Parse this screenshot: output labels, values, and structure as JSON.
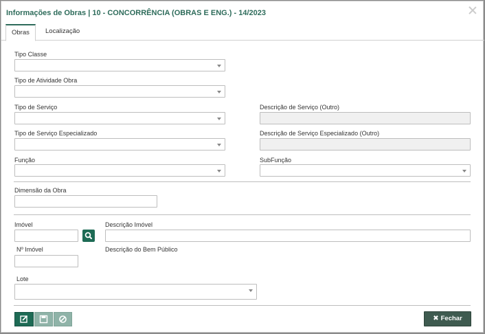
{
  "dialog": {
    "title": "Informações de Obras | 10 - CONCORRÊNCIA (OBRAS E ENG.) - 14/2023"
  },
  "tabs": [
    {
      "label": "Obras",
      "active": true
    },
    {
      "label": "Localização",
      "active": false
    }
  ],
  "form": {
    "tipo_classe": {
      "label": "Tipo Classe",
      "value": ""
    },
    "tipo_atividade": {
      "label": "Tipo de Atividade Obra",
      "value": ""
    },
    "tipo_servico": {
      "label": "Tipo de Serviço",
      "value": ""
    },
    "descricao_servico_outro": {
      "label": "Descrição de Serviço (Outro)",
      "value": ""
    },
    "tipo_servico_especializado": {
      "label": "Tipo de Serviço Especializado",
      "value": ""
    },
    "descricao_servico_especializado_outro": {
      "label": "Descrição de Serviço Especializado (Outro)",
      "value": ""
    },
    "funcao": {
      "label": "Função",
      "value": ""
    },
    "subfuncao": {
      "label": "SubFunção",
      "value": ""
    },
    "dimensao": {
      "label": "Dimensão da Obra",
      "value": ""
    },
    "imovel": {
      "label": "Imóvel",
      "value": ""
    },
    "descricao_imovel": {
      "label": "Descrição Imóvel",
      "value": ""
    },
    "n_imovel": {
      "label": "Nº Imóvel",
      "value": ""
    },
    "descricao_bem_publico": {
      "label": "Descrição do Bem Público"
    },
    "lote": {
      "label": "Lote",
      "value": ""
    }
  },
  "footer": {
    "fechar_label": "Fechar"
  },
  "colors": {
    "accent": "#1e6b55",
    "title": "#2d6b5a",
    "button_disabled": "#8fb3a8",
    "close_button": "#3f5b50"
  },
  "icons": [
    "search-icon",
    "edit-icon",
    "save-icon",
    "cancel-icon",
    "close-icon"
  ]
}
